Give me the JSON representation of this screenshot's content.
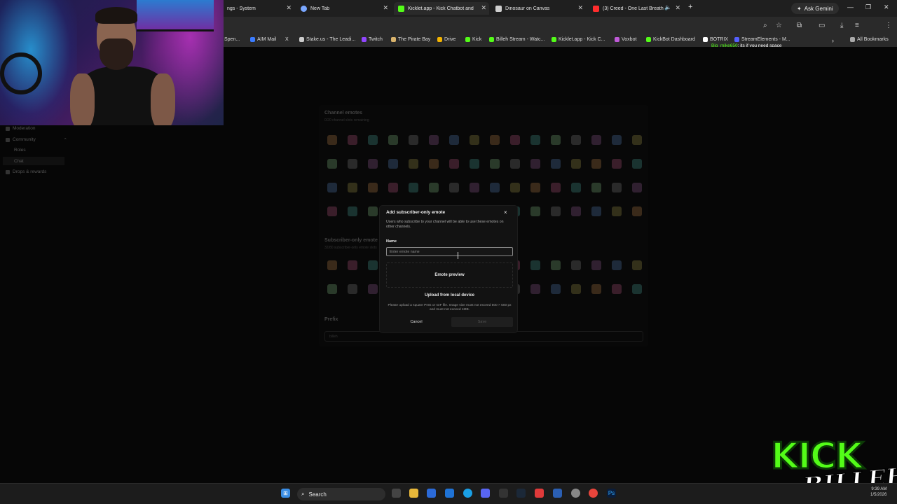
{
  "browser": {
    "tabs": [
      {
        "label": "ngs - System",
        "color": "#6a6a6a"
      },
      {
        "label": "New Tab",
        "color": "#7aa7ff"
      },
      {
        "label": "Kicklet.app - Kick Chatbot and",
        "color": "#53fc18"
      },
      {
        "label": "Dinosaur on Canvas",
        "color": "#cfcfcf"
      },
      {
        "label": "(3) Creed - One Last Breath",
        "color": "#ff2d2d"
      }
    ],
    "new_tab": "+",
    "ask_gemini": "Ask Gemini",
    "window_controls": [
      "—",
      "❐",
      "✕"
    ],
    "toolbar_icons": [
      "search-icon",
      "star-icon",
      "extensions-icon",
      "cast-icon",
      "download-icon",
      "media-icon",
      "menu-icon"
    ],
    "bookmarks": [
      {
        "label": "Spen...",
        "color": "#888"
      },
      {
        "label": "AIM Mail",
        "color": "#3b7cff"
      },
      {
        "label": "X",
        "color": "#cccccc"
      },
      {
        "label": "Stake.us - The Leadi...",
        "color": "#cccccc"
      },
      {
        "label": "Twitch",
        "color": "#9146ff"
      },
      {
        "label": "The Pirate Bay",
        "color": "#d9b36c"
      },
      {
        "label": "Drive",
        "color": "#f4b400"
      },
      {
        "label": "Kick",
        "color": "#53fc18"
      },
      {
        "label": "Billeh Stream - Watc...",
        "color": "#53fc18"
      },
      {
        "label": "Kicklet.app - Kick C...",
        "color": "#53fc18"
      },
      {
        "label": "Voxbot",
        "color": "#c05ad8"
      },
      {
        "label": "KickBot Dashboard",
        "color": "#53fc18"
      },
      {
        "label": "BOTRIX",
        "color": "#ffffff"
      },
      {
        "label": "StreamElements - M...",
        "color": "#5560ff"
      }
    ],
    "all_bookmarks": "All Bookmarks",
    "chat_overlay": {
      "user": "Big_mike650",
      "message": "its if you need space"
    }
  },
  "sidebar": {
    "items": [
      {
        "label": "Moderation",
        "selected": false
      },
      {
        "label": "Community",
        "selected": false
      },
      {
        "label": "Roles",
        "selected": false
      },
      {
        "label": "Chat",
        "selected": true
      },
      {
        "label": "Drops & rewards",
        "selected": false
      }
    ]
  },
  "background": {
    "channel_emotes_title": "Channel emotes",
    "channel_emotes_sub": "0/20 channel slots remaining",
    "subscriber_emotes_title": "Subscriber-only emote",
    "subscriber_emotes_sub": "32/80 subscriber-only emote slots",
    "prefix_title": "Prefix",
    "prefix_value": "billeh"
  },
  "modal": {
    "title": "Add subscriber-only emote",
    "close": "×",
    "description": "Users who subscribe to your channel will be able to use these emotes on other channels.",
    "name_label": "Name",
    "name_placeholder": "Enter emote name",
    "name_value": "",
    "preview_label": "Emote preview",
    "upload_label": "Upload from local device",
    "hint": "Please upload a square PNG or GIF file. Image size must not exceed 500 × 500 px and must not exceed 1MB.",
    "cancel_label": "Cancel",
    "save_label": "Save"
  },
  "overlay": {
    "logo_line1": "KICK",
    "logo_line2": "BILLEH"
  },
  "taskbar": {
    "search_label": "Search",
    "clock_time": "9:39 AM",
    "clock_date": "1/5/2026"
  }
}
